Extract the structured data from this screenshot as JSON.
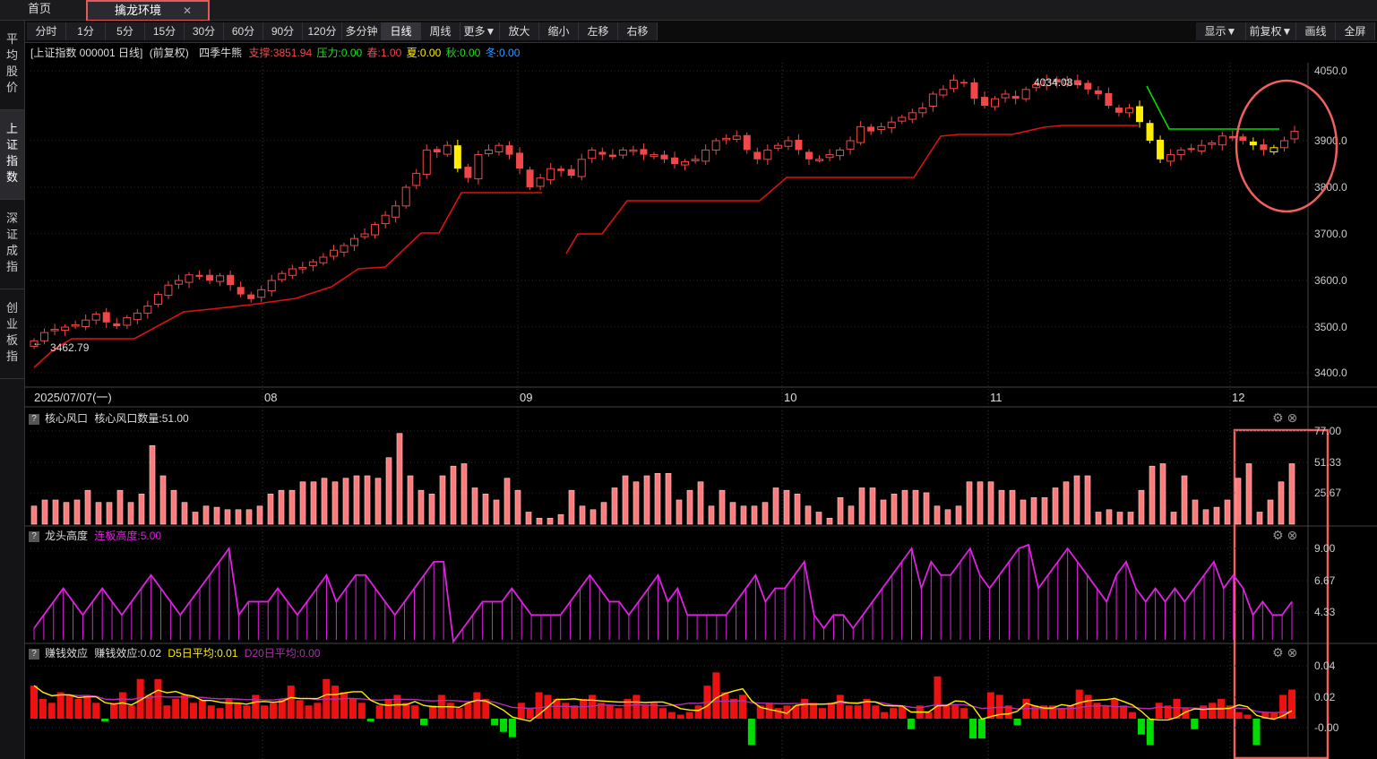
{
  "tabs": {
    "home": "首页",
    "active": "擒龙环境",
    "close": "✕"
  },
  "sidebar": [
    {
      "label": "平\n均\n股\n价",
      "active": false
    },
    {
      "label": "上\n证\n指\n数",
      "active": true
    },
    {
      "label": "深\n证\n成\n指",
      "active": false
    },
    {
      "label": "创\n业\n板\n指",
      "active": false
    }
  ],
  "toolbar_left": [
    "分时",
    "1分",
    "5分",
    "15分",
    "30分",
    "60分",
    "90分",
    "120分",
    "多分钟",
    "日线",
    "周线",
    "更多▼",
    "放大",
    "缩小",
    "左移",
    "右移"
  ],
  "toolbar_selected": "日线",
  "toolbar_right": [
    "显示▼",
    "前复权▼",
    "画线",
    "全屏"
  ],
  "header": {
    "symbol": "[上证指数 000001 日线]",
    "adjust": "(前复权)",
    "indicator": "四季牛熊",
    "support": "支撑:3851.94",
    "pressure": "压力:0.00",
    "spring": "春:1.00",
    "summer": "夏:0.00",
    "autumn": "秋:0.00",
    "winter": "冬:0.00"
  },
  "colors": {
    "up": "#f04848",
    "down": "#f04848",
    "yellow": "#ffee00",
    "support_line": "#e01010",
    "pressure_line": "#00dd00",
    "magenta": "#e020e0",
    "green": "#00dd00",
    "pink": "#ff9090"
  },
  "panels": {
    "p1": {
      "name": "核心风口",
      "value": "核心风口数量:51.00"
    },
    "p2": {
      "name": "龙头高度",
      "value": "连板高度:5.00"
    },
    "p3": {
      "name": "赚钱效应",
      "value": "赚钱效应:0.02",
      "d5": "D5日平均:0.01",
      "d20": "D20日平均:0.00"
    }
  },
  "chart_data": [
    {
      "type": "candlestick",
      "title": "上证指数 000001 日线",
      "start_date_label": "2025/07/07(一)",
      "x_month_labels": [
        "08",
        "09",
        "10",
        "11",
        "12"
      ],
      "ylim": [
        3380,
        4080
      ],
      "y_ticks": [
        3400,
        3500,
        3600,
        3700,
        3800,
        3900,
        4050
      ],
      "y_tick_labels": [
        "3400.0",
        "3500.0",
        "3600.0",
        "3700.0",
        "3800.0",
        "3900.0",
        "4050.0"
      ],
      "annotations": {
        "high": "4034.08",
        "low": "3462.79"
      },
      "close": [
        3470,
        3488,
        3495,
        3500,
        3505,
        3515,
        3528,
        3510,
        3502,
        3520,
        3530,
        3545,
        3570,
        3590,
        3600,
        3612,
        3608,
        3600,
        3610,
        3590,
        3570,
        3560,
        3580,
        3600,
        3615,
        3625,
        3628,
        3640,
        3650,
        3665,
        3675,
        3690,
        3700,
        3720,
        3740,
        3760,
        3800,
        3830,
        3880,
        3875,
        3890,
        3840,
        3820,
        3870,
        3880,
        3890,
        3870,
        3840,
        3800,
        3820,
        3840,
        3835,
        3825,
        3860,
        3880,
        3870,
        3865,
        3880,
        3880,
        3870,
        3870,
        3860,
        3850,
        3855,
        3860,
        3880,
        3900,
        3905,
        3910,
        3880,
        3860,
        3880,
        3890,
        3900,
        3880,
        3860,
        3860,
        3870,
        3880,
        3900,
        3930,
        3920,
        3930,
        3940,
        3950,
        3960,
        3970,
        4000,
        4010,
        4030,
        4025,
        3990,
        3975,
        3990,
        4000,
        3990,
        4010,
        4020,
        4030,
        4025,
        4030,
        4020,
        4010,
        4000,
        3975,
        3960,
        3970,
        3940,
        3900,
        3860,
        3870,
        3880,
        3880,
        3890,
        3895,
        3910,
        3905,
        3900,
        3890,
        3880,
        3885,
        3900,
        3920
      ],
      "support_line": "red stepped trailing line",
      "pressure_line": "green line near end"
    },
    {
      "type": "bar",
      "title": "核心风口",
      "series_name": "核心风口数量",
      "y_tick_labels": [
        "77.00",
        "51.33",
        "25.67"
      ],
      "ylim": [
        0,
        77
      ],
      "values": [
        15,
        20,
        20,
        18,
        20,
        28,
        18,
        18,
        28,
        18,
        25,
        65,
        40,
        28,
        18,
        10,
        15,
        14,
        12,
        12,
        12,
        15,
        25,
        28,
        28,
        35,
        35,
        38,
        35,
        38,
        40,
        40,
        38,
        55,
        75,
        40,
        28,
        25,
        40,
        48,
        50,
        30,
        25,
        20,
        38,
        28,
        10,
        5,
        5,
        8,
        28,
        15,
        12,
        18,
        30,
        40,
        35,
        40,
        42,
        42,
        20,
        28,
        35,
        15,
        28,
        18,
        15,
        15,
        18,
        30,
        28,
        25,
        15,
        10,
        5,
        22,
        15,
        30,
        30,
        20,
        25,
        28,
        28,
        26,
        15,
        12,
        15,
        35,
        35,
        35,
        28,
        28,
        20,
        22,
        22,
        30,
        35,
        40,
        40,
        10,
        12,
        10,
        10,
        28,
        48,
        50,
        10,
        40,
        20,
        12,
        14,
        20,
        38,
        50,
        10,
        20,
        35,
        50
      ]
    },
    {
      "type": "line",
      "title": "龙头高度",
      "series_name": "连板高度",
      "y_tick_labels": [
        "9.00",
        "6.67",
        "4.33"
      ],
      "ylim": [
        2,
        9.5
      ],
      "values": [
        3,
        4,
        5,
        6,
        5,
        4,
        5,
        6,
        5,
        4,
        5,
        6,
        7,
        6,
        5,
        4,
        5,
        6,
        7,
        8,
        9,
        4,
        5,
        5,
        5,
        6,
        5,
        4,
        5,
        6,
        7,
        5,
        6,
        7,
        7,
        6,
        5,
        4,
        5,
        6,
        7,
        8,
        8,
        2,
        3,
        4,
        5,
        5,
        5,
        6,
        5,
        4,
        4,
        4,
        4,
        5,
        6,
        7,
        6,
        5,
        5,
        4,
        5,
        6,
        7,
        5,
        6,
        4,
        4,
        4,
        4,
        4,
        5,
        6,
        7,
        5,
        6,
        6,
        7,
        8,
        4,
        3,
        4,
        4,
        3,
        4,
        5,
        6,
        7,
        8,
        9,
        6,
        8,
        7,
        7,
        8,
        9,
        7,
        6,
        7,
        8,
        9,
        10,
        6,
        7,
        8,
        9,
        8,
        7,
        6,
        5,
        7,
        8,
        6,
        5,
        6,
        5,
        6,
        5,
        6,
        7,
        8,
        6,
        7,
        6,
        4,
        5,
        4,
        4,
        5
      ]
    },
    {
      "type": "bar+line",
      "title": "赚钱效应",
      "series": [
        {
          "name": "赚钱效应",
          "values": [
            0.025,
            0.015,
            0.012,
            0.02,
            0.018,
            0.015,
            0.018,
            0.012,
            -0.002,
            0.012,
            0.02,
            0.01,
            0.03,
            0.018,
            0.03,
            0.01,
            0.015,
            0.018,
            0.012,
            0.014,
            0.01,
            0.008,
            0.015,
            0.012,
            0.01,
            0.018,
            0.01,
            0.012,
            0.015,
            0.025,
            0.014,
            0.01,
            0.012,
            0.03,
            0.025,
            0.02,
            0.015,
            0.012,
            -0.002,
            0.01,
            0.015,
            0.018,
            0.012,
            0.01,
            -0.005,
            0.01,
            0.018,
            0.012,
            0.008,
            0.012,
            0.02,
            0.015,
            -0.005,
            -0.01,
            -0.014,
            0.012,
            0.008,
            0.02,
            0.018,
            0.015,
            0.012,
            0.01,
            0.015,
            0.018,
            0.012,
            0.01,
            0.008,
            0.015,
            0.018,
            0.01,
            0.012,
            0.008,
            0.005,
            0.003,
            0.005,
            0.01,
            0.025,
            0.035,
            0.02,
            0.015,
            0.018,
            -0.02,
            0.01,
            0.012,
            0.008,
            0.01,
            0.01,
            0.015,
            0.012,
            0.008,
            0.012,
            0.018,
            0.01,
            0.01,
            0.015,
            0.01,
            0.005,
            0.008,
            0.01,
            -0.008,
            0.01,
            0.005,
            0.032,
            0.01,
            0.01,
            0.008,
            -0.015,
            -0.015,
            0.02,
            0.018,
            0.01,
            -0.005,
            0.015,
            0.01,
            0.01,
            0.01,
            0.008,
            0.01,
            0.022,
            0.018,
            0.012,
            0.01,
            0.015,
            0.01,
            0.005,
            -0.012,
            -0.02,
            0.012,
            0.01,
            0.015,
            0.008,
            -0.008,
            0.01,
            0.012,
            0.015,
            0.01,
            0.005,
            0.003,
            -0.02,
            0.005,
            0.005,
            0.018,
            0.022
          ]
        },
        {
          "name": "D5日平均",
          "color": "#ffee00"
        },
        {
          "name": "D20日平均",
          "color": "#b030b0"
        }
      ],
      "y_tick_labels": [
        "0.04",
        "0.02",
        "-0.00"
      ],
      "ylim": [
        -0.02,
        0.04
      ]
    }
  ]
}
